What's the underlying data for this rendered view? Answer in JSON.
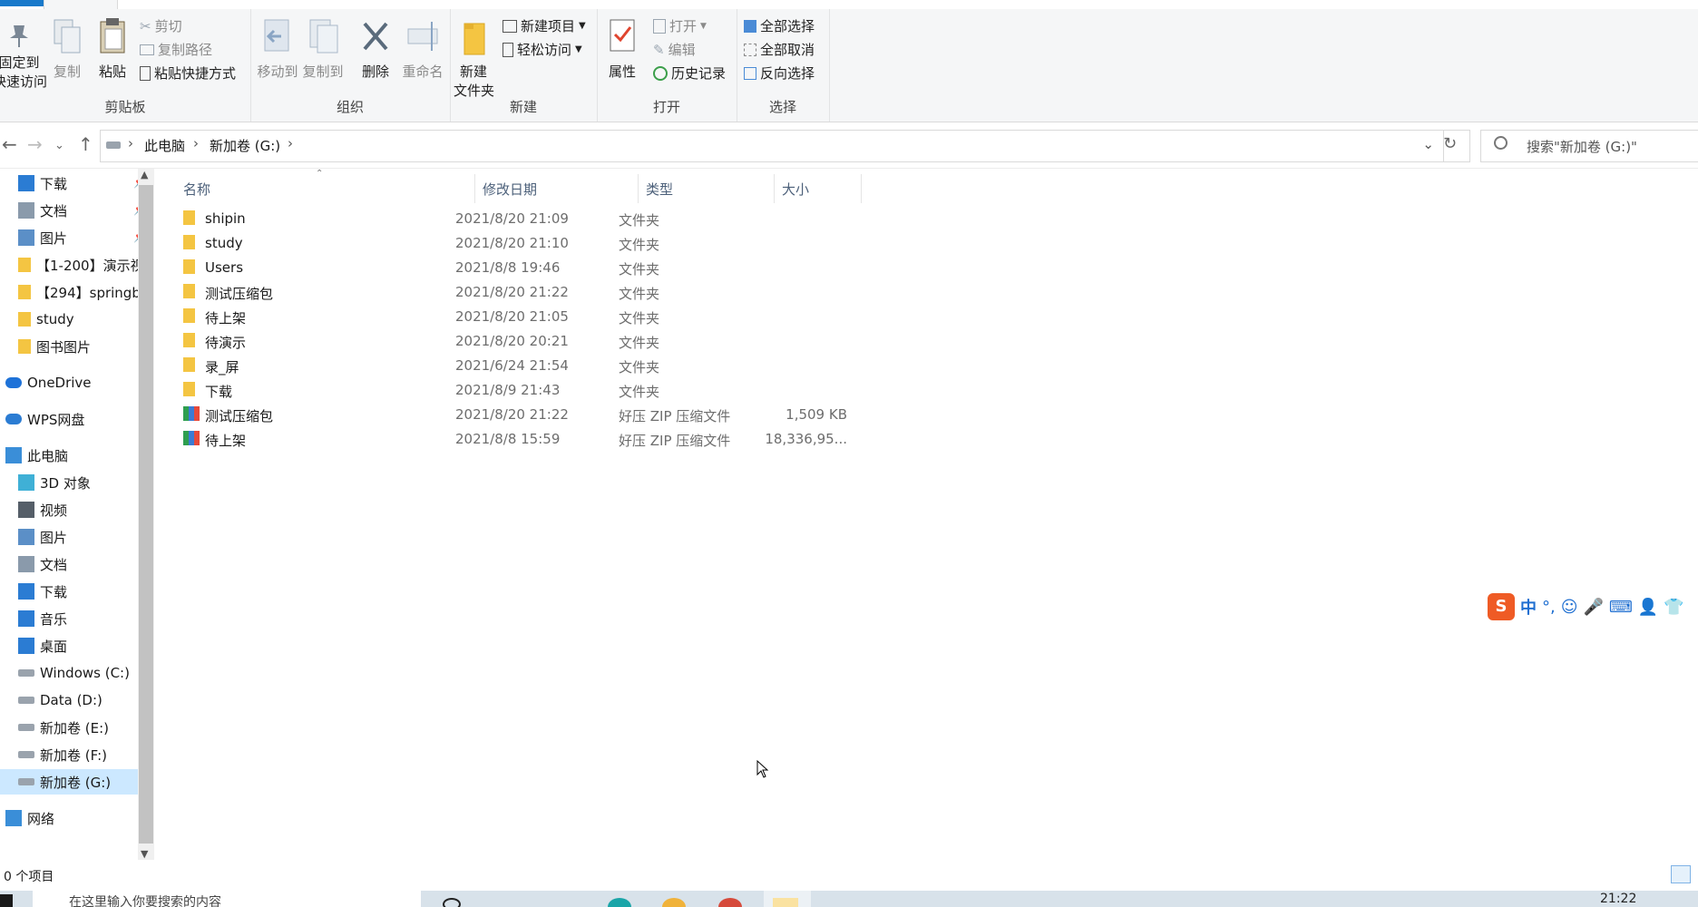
{
  "ribbon": {
    "clipboard": {
      "pin_label": "固定到\n快速访问",
      "copy_label": "复制",
      "paste_label": "粘贴",
      "cut_label": "剪切",
      "copy_path_label": "复制路径",
      "paste_shortcut_label": "粘贴快捷方式",
      "group_label": "剪贴板"
    },
    "organize": {
      "move_to_label": "移动到",
      "copy_to_label": "复制到",
      "delete_label": "删除",
      "rename_label": "重命名",
      "group_label": "组织"
    },
    "new": {
      "new_folder_label": "新建\n文件夹",
      "new_item_label": "新建项目",
      "easy_access_label": "轻松访问",
      "group_label": "新建"
    },
    "open": {
      "properties_label": "属性",
      "open_label": "打开",
      "edit_label": "编辑",
      "history_label": "历史记录",
      "group_label": "打开"
    },
    "select": {
      "select_all_label": "全部选择",
      "select_none_label": "全部取消",
      "invert_label": "反向选择",
      "group_label": "选择"
    }
  },
  "address": {
    "crumbs": [
      "此电脑",
      "新加卷 (G:)"
    ],
    "search_placeholder": "搜索\"新加卷 (G:)\""
  },
  "nav": {
    "quick": [
      {
        "label": "下载",
        "icon": "download-icon",
        "pinned": true
      },
      {
        "label": "文档",
        "icon": "document-icon",
        "pinned": true
      },
      {
        "label": "图片",
        "icon": "picture-icon",
        "pinned": true
      },
      {
        "label": "【1-200】演示视",
        "icon": "folder-icon",
        "pinned": false
      },
      {
        "label": "【294】springb",
        "icon": "folder-icon",
        "pinned": false
      },
      {
        "label": "study",
        "icon": "folder-icon",
        "pinned": false
      },
      {
        "label": "图书图片",
        "icon": "folder-icon",
        "pinned": false
      }
    ],
    "onedrive": "OneDrive",
    "wps": "WPS网盘",
    "thispc": "此电脑",
    "pc_items": [
      {
        "label": "3D 对象",
        "icon": "3d-objects-icon"
      },
      {
        "label": "视频",
        "icon": "video-icon"
      },
      {
        "label": "图片",
        "icon": "picture-icon"
      },
      {
        "label": "文档",
        "icon": "document-icon"
      },
      {
        "label": "下载",
        "icon": "download-icon"
      },
      {
        "label": "音乐",
        "icon": "music-icon"
      },
      {
        "label": "桌面",
        "icon": "desktop-icon"
      },
      {
        "label": "Windows (C:)",
        "icon": "drive-icon"
      },
      {
        "label": "Data (D:)",
        "icon": "drive-icon"
      },
      {
        "label": "新加卷 (E:)",
        "icon": "drive-icon"
      },
      {
        "label": "新加卷 (F:)",
        "icon": "drive-icon"
      },
      {
        "label": "新加卷 (G:)",
        "icon": "drive-icon",
        "selected": true
      }
    ],
    "network": "网络"
  },
  "columns": {
    "name": "名称",
    "date": "修改日期",
    "type": "类型",
    "size": "大小"
  },
  "files": [
    {
      "name": "shipin",
      "date": "2021/8/20 21:09",
      "type": "文件夹",
      "size": "",
      "kind": "folder"
    },
    {
      "name": "study",
      "date": "2021/8/20 21:10",
      "type": "文件夹",
      "size": "",
      "kind": "folder"
    },
    {
      "name": "Users",
      "date": "2021/8/8 19:46",
      "type": "文件夹",
      "size": "",
      "kind": "folder"
    },
    {
      "name": "测试压缩包",
      "date": "2021/8/20 21:22",
      "type": "文件夹",
      "size": "",
      "kind": "folder"
    },
    {
      "name": "待上架",
      "date": "2021/8/20 21:05",
      "type": "文件夹",
      "size": "",
      "kind": "folder"
    },
    {
      "name": "待演示",
      "date": "2021/8/20 20:21",
      "type": "文件夹",
      "size": "",
      "kind": "folder"
    },
    {
      "name": "录_屏",
      "date": "2021/6/24 21:54",
      "type": "文件夹",
      "size": "",
      "kind": "folder"
    },
    {
      "name": "下载",
      "date": "2021/8/9 21:43",
      "type": "文件夹",
      "size": "",
      "kind": "folder"
    },
    {
      "name": "测试压缩包",
      "date": "2021/8/20 21:22",
      "type": "好压 ZIP 压缩文件",
      "size": "1,509 KB",
      "kind": "zip"
    },
    {
      "name": "待上架",
      "date": "2021/8/8 15:59",
      "type": "好压 ZIP 压缩文件",
      "size": "18,336,95...",
      "kind": "zip"
    }
  ],
  "status": {
    "item_count": "0 个项目"
  },
  "taskbar": {
    "search_text": "在这里输入你要搜索的内容",
    "clock": "21:22"
  },
  "ime": {
    "mode_label": "中"
  },
  "colors": {
    "accent": "#1979ca",
    "folder": "#f4c542",
    "selected": "#cce8ff",
    "sogou": "#ef5b25"
  }
}
